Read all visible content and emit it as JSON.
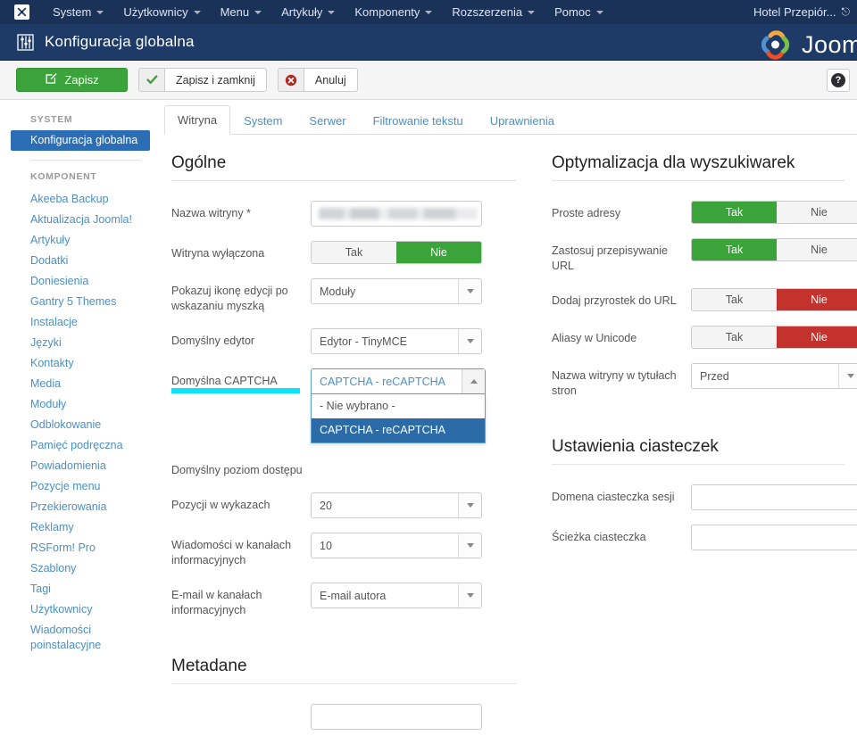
{
  "topbar": {
    "brand_icon": "joomla-logo-icon",
    "items": [
      {
        "label": "System",
        "has_caret": true
      },
      {
        "label": "Użytkownicy",
        "has_caret": true
      },
      {
        "label": "Menu",
        "has_caret": true
      },
      {
        "label": "Artykuły",
        "has_caret": true
      },
      {
        "label": "Komponenty",
        "has_caret": true
      },
      {
        "label": "Rozszerzenia",
        "has_caret": true
      },
      {
        "label": "Pomoc",
        "has_caret": true
      }
    ],
    "site_link": "Hotel Przepiór...",
    "site_link_icon": "external-link-icon"
  },
  "header": {
    "title": "Konfiguracja globalna",
    "title_icon": "sliders-icon",
    "logo_text": "Joom",
    "logo_icon": "joomla-brand-icon"
  },
  "toolbar": {
    "save_label": "Zapisz",
    "save_icon": "pencil-square-icon",
    "save_close_label": "Zapisz i zamknij",
    "save_close_icon": "check-icon",
    "cancel_label": "Anuluj",
    "cancel_icon": "times-circle-icon",
    "help_label": "?",
    "accent_green": "#3aa33a",
    "accent_red": "#c4322e"
  },
  "sidebar": {
    "group_system_label": "SYSTEM",
    "system_items": [
      {
        "label": "Konfiguracja globalna",
        "active": true
      }
    ],
    "group_component_label": "KOMPONENT",
    "component_items": [
      {
        "label": "Akeeba Backup"
      },
      {
        "label": "Aktualizacja Joomla!"
      },
      {
        "label": "Artykuły"
      },
      {
        "label": "Dodatki"
      },
      {
        "label": "Doniesienia"
      },
      {
        "label": "Gantry 5 Themes"
      },
      {
        "label": "Instalacje"
      },
      {
        "label": "Języki"
      },
      {
        "label": "Kontakty"
      },
      {
        "label": "Media"
      },
      {
        "label": "Moduły"
      },
      {
        "label": "Odblokowanie"
      },
      {
        "label": "Pamięć podręczna"
      },
      {
        "label": "Powiadomienia"
      },
      {
        "label": "Pozycje menu"
      },
      {
        "label": "Przekierowania"
      },
      {
        "label": "Reklamy"
      },
      {
        "label": "RSForm! Pro"
      },
      {
        "label": "Szablony"
      },
      {
        "label": "Tagi"
      },
      {
        "label": "Użytkownicy"
      },
      {
        "label": "Wiadomości poinstalacyjne"
      }
    ],
    "active_color": "#2b6eb5"
  },
  "tabs": [
    {
      "label": "Witryna",
      "active": true
    },
    {
      "label": "System",
      "active": false
    },
    {
      "label": "Serwer",
      "active": false
    },
    {
      "label": "Filtrowanie tekstu",
      "active": false
    },
    {
      "label": "Uprawnienia",
      "active": false
    }
  ],
  "left_column": {
    "section_general_title": "Ogólne",
    "fields": {
      "site_name_label": "Nazwa witryny *",
      "site_name_value": "",
      "site_offline_label": "Witryna wyłączona",
      "site_offline_yes": "Tak",
      "site_offline_no": "Nie",
      "site_offline_state": "Nie",
      "edit_icon_label": "Pokazuj ikonę edycji po wskazaniu myszką",
      "edit_icon_value": "Moduły",
      "default_editor_label": "Domyślny edytor",
      "default_editor_value": "Edytor - TinyMCE",
      "captcha_label": "Domyślna CAPTCHA",
      "captcha_value": "CAPTCHA - reCAPTCHA",
      "captcha_options": [
        {
          "label": "- Nie wybrano -",
          "selected": false
        },
        {
          "label": "CAPTCHA - reCAPTCHA",
          "selected": true
        }
      ],
      "captcha_highlight_color": "#09e3fb",
      "access_level_label": "Domyślny poziom dostępu",
      "list_limit_label": "Pozycji w wykazach",
      "list_limit_value": "20",
      "feed_limit_label": "Wiadomości w kanałach informacyjnych",
      "feed_limit_value": "10",
      "feed_email_label": "E-mail w kanałach informacyjnych",
      "feed_email_value": "E-mail autora"
    },
    "section_metadata_title": "Metadane"
  },
  "right_column": {
    "section_seo_title": "Optymalizacja dla wyszukiwarek",
    "fields": {
      "sef_label": "Proste adresy",
      "sef_yes": "Tak",
      "sef_no": "Nie",
      "sef_state": "Tak",
      "rewrite_label": "Zastosuj przepisywanie URL",
      "rewrite_state": "Tak",
      "suffix_label": "Dodaj przyrostek do URL",
      "suffix_state": "Nie",
      "unicode_label": "Aliasy w Unicode",
      "unicode_state": "Nie",
      "sitename_in_titles_label": "Nazwa witryny w tytułach stron",
      "sitename_in_titles_value": "Przed"
    },
    "section_cookie_title": "Ustawienia ciasteczek",
    "cookie_fields": {
      "domain_label": "Domena ciasteczka sesji",
      "domain_value": "",
      "path_label": "Ścieżka ciasteczka",
      "path_value": ""
    }
  }
}
